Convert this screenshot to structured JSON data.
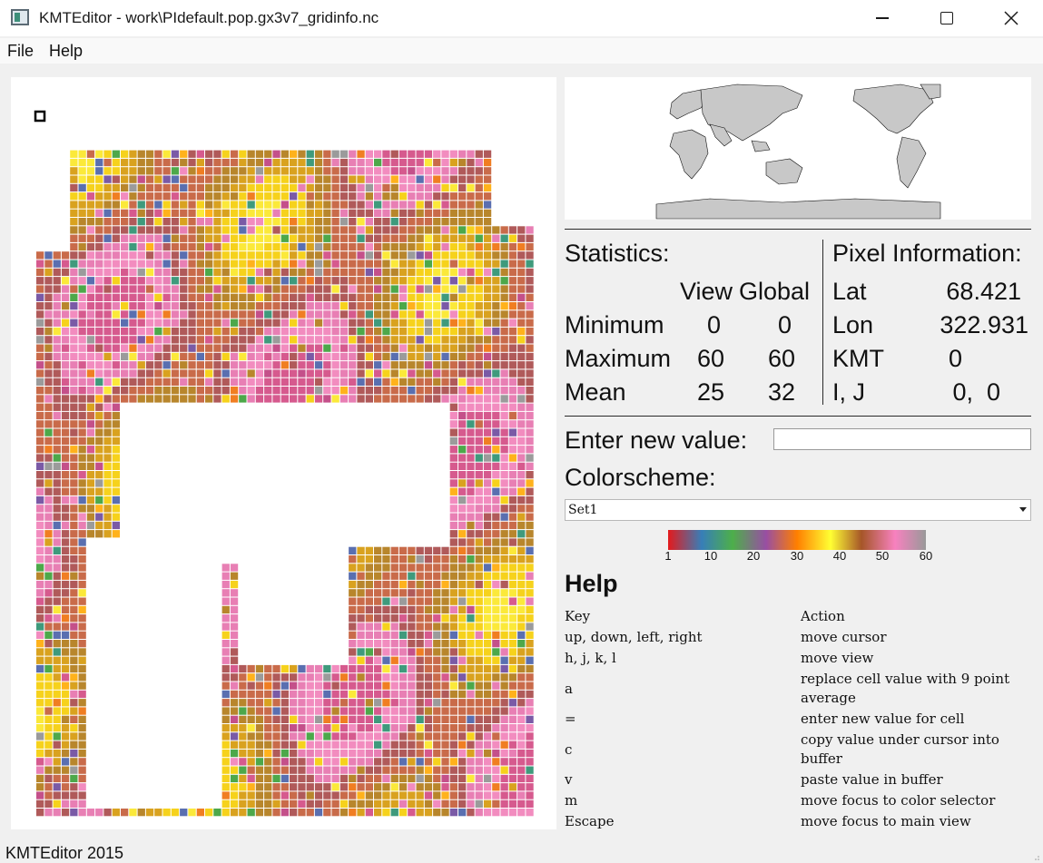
{
  "window": {
    "title": "KMTEditor - work\\PIdefault.pop.gx3v7_gridinfo.nc"
  },
  "menu": {
    "file": "File",
    "help": "Help"
  },
  "statistics": {
    "heading": "Statistics:",
    "col_view": "View",
    "col_global": "Global",
    "rows": [
      {
        "label": "Minimum",
        "view": "0",
        "global": "0"
      },
      {
        "label": "Maximum",
        "view": "60",
        "global": "60"
      },
      {
        "label": "Mean",
        "view": "25",
        "global": "32"
      }
    ]
  },
  "pixel_info": {
    "heading": "Pixel Information:",
    "rows": [
      {
        "label": "Lat",
        "value": "68.421"
      },
      {
        "label": "Lon",
        "value": "322.931"
      },
      {
        "label": "KMT",
        "value": "0"
      },
      {
        "label": "I, J",
        "value": "0,  0"
      }
    ]
  },
  "new_value": {
    "label": "Enter new value:",
    "value": ""
  },
  "colorscheme": {
    "label": "Colorscheme:",
    "selected": "Set1"
  },
  "colorbar": {
    "ticks": [
      "1",
      "10",
      "20",
      "30",
      "40",
      "50",
      "60"
    ],
    "colors": [
      "#e41a1c",
      "#377eb8",
      "#4daf4a",
      "#984ea3",
      "#ff7f00",
      "#ffff33",
      "#a65628",
      "#f781bf",
      "#999999"
    ]
  },
  "help": {
    "title": "Help",
    "header_key": "Key",
    "header_action": "Action",
    "rows": [
      {
        "key": "up, down, left, right",
        "action": "move cursor"
      },
      {
        "key": "h, j, k, l",
        "action": "move view"
      },
      {
        "key": "a",
        "action": "replace cell value with 9 point average"
      },
      {
        "key": "=",
        "action": "enter new value for cell"
      },
      {
        "key": "c",
        "action": "copy value under cursor into buffer"
      },
      {
        "key": "v",
        "action": "paste value in buffer"
      },
      {
        "key": "m",
        "action": "move focus to color selector"
      },
      {
        "key": "Escape",
        "action": "move focus to main view"
      }
    ]
  },
  "status": {
    "text": "KMTEditor 2015"
  },
  "icons": {
    "app": "kmteditor-app-icon",
    "minimize": "minimize-icon",
    "maximize": "maximize-icon",
    "close": "close-icon",
    "dropdown": "chevron-down-icon"
  }
}
